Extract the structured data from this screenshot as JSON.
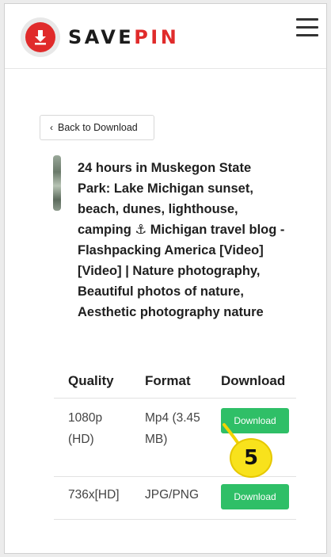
{
  "header": {
    "logo_text_dark": "SAVE",
    "logo_text_red": "PIN"
  },
  "back_button": {
    "label": "Back to Download"
  },
  "media": {
    "title": "24 hours in Muskegon State Park: Lake Michigan sunset, beach, dunes, lighthouse, camping ⚓ Michigan travel blog - Flashpacking America [Video] [Video] | Nature photography, Beautiful photos of nature, Aesthetic photography nature"
  },
  "table": {
    "headers": [
      "Quality",
      "Format",
      "Download"
    ],
    "rows": [
      {
        "quality": "1080p (HD)",
        "format": "Mp4 (3.45 MB)",
        "button": "Download"
      },
      {
        "quality": "736x[HD]",
        "format": "JPG/PNG",
        "button": "Download"
      }
    ]
  },
  "annotation": {
    "step": "5"
  },
  "colors": {
    "brand_red": "#e02b2b",
    "download_green": "#2fbf67",
    "annotation_yellow": "#f8e21c"
  }
}
